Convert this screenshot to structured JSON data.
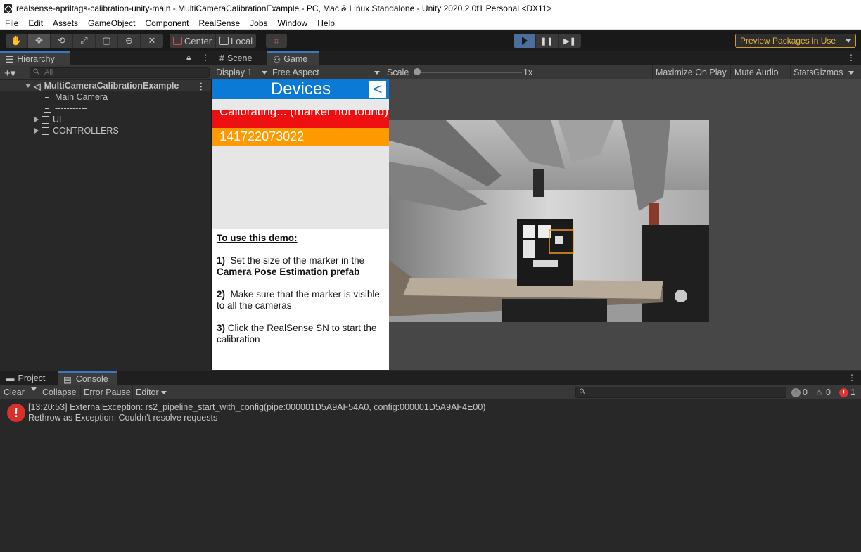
{
  "window": {
    "title": "realsense-apriltags-calibration-unity-main - MultiCameraCalibrationExample - PC, Mac & Linux Standalone - Unity 2020.2.0f1 Personal <DX11>"
  },
  "menu": [
    "File",
    "Edit",
    "Assets",
    "GameObject",
    "Component",
    "RealSense",
    "Jobs",
    "Window",
    "Help"
  ],
  "toolbar": {
    "pivot_center": "Center",
    "pivot_local": "Local",
    "preview_packages": "Preview Packages in Use"
  },
  "hierarchy": {
    "tab": "Hierarchy",
    "search_placeholder": "All",
    "root": "MultiCameraCalibrationExample",
    "items": [
      "Main Camera",
      "-----------",
      "UI",
      "CONTROLLERS"
    ]
  },
  "game_panel": {
    "tab_scene": "Scene",
    "tab_game": "Game",
    "display": "Display 1",
    "aspect": "Free Aspect",
    "scale_label": "Scale",
    "scale_value": "1x",
    "maximize_on_play": "Maximize On Play",
    "mute_audio": "Mute Audio",
    "stats": "Stats",
    "gizmos": "Gizmos"
  },
  "game_ui": {
    "devices_title": "Devices",
    "back_label": "<",
    "status": "Calibrating... (marker not found)",
    "serial": "141722073022",
    "instructions_title": "To use this demo:",
    "step1_num": "1)",
    "step1_text": "Set the size of the marker in the",
    "step1_bold": "Camera Pose Estimation prefab",
    "step2_num": "2)",
    "step2_text": "Make sure that the marker is visible to all the cameras",
    "step3_num": "3)",
    "step3_text": "Click the RealSense SN to start the calibration"
  },
  "console": {
    "tab_project": "Project",
    "tab_console": "Console",
    "clear": "Clear",
    "collapse": "Collapse",
    "error_pause": "Error Pause",
    "editor": "Editor",
    "info_count": "0",
    "warn_count": "0",
    "error_count": "1",
    "log_line1": "[13:20:53] ExternalException: rs2_pipeline_start_with_config(pipe:000001D5A9AF54A0, config:000001D5A9AF4E00)",
    "log_line2": "Rethrow as Exception: Couldn't resolve requests"
  },
  "colors": {
    "accent_blue": "#0b79d6",
    "status_red": "#ee1010",
    "serial_orange": "#ff9900",
    "play_active": "#4a6f9c",
    "preview_border": "#d19c2c"
  }
}
